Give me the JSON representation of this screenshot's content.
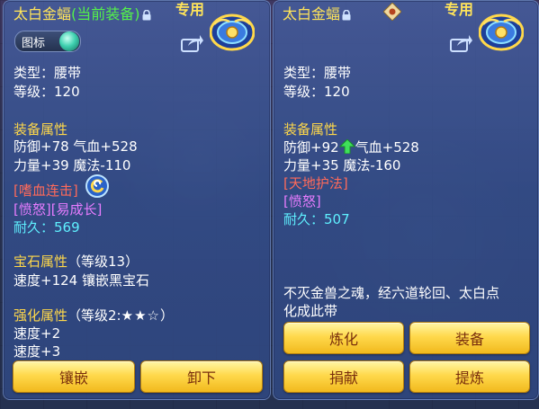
{
  "left": {
    "title_name": "太白金蝠",
    "title_status": "(当前装备)",
    "exclusive": "专用",
    "badge_label": "图标",
    "type_line": "类型：腰带",
    "level_line": "等级：120",
    "attr_header": "装备属性",
    "stat_line1": "防御+78 气血+528",
    "stat_line2": "力量+39 魔法-110",
    "special_skill": "[嗜血连击]",
    "effects": "[愤怒][易成长]",
    "durability_label": "耐久：",
    "durability_value": "569",
    "gem_header": "宝石属性",
    "gem_level": "（等级13）",
    "gem_line": "速度+124 镶嵌黑宝石",
    "enhance_header": "强化属性",
    "enhance_level": "（等级2:",
    "enhance_stars": "★★☆",
    "enhance_close": "）",
    "enhance_line1": "速度+2",
    "enhance_line2": "速度+3",
    "btn_inlay": "镶嵌",
    "btn_unequip": "卸下"
  },
  "right": {
    "title_name": "太白金蝠",
    "exclusive": "专用",
    "type_line": "类型：腰带",
    "level_line": "等级：120",
    "attr_header": "装备属性",
    "stat_line1a": "防御+92",
    "stat_line1b": "气血+528",
    "stat_line2": "力量+35 魔法-160",
    "special_skill": "[天地护法]",
    "effects": "[愤怒]",
    "durability_label": "耐久：",
    "durability_value": "507",
    "desc_line1": "不灭金兽之魂，经六道轮回、太白点",
    "desc_line2": "化成此带",
    "btn_refine": "炼化",
    "btn_equip": "装备",
    "btn_donate": "捐献",
    "btn_extract": "提炼"
  },
  "colors": {
    "title": "#ffe45a",
    "equipped": "#54f24a",
    "section": "#ffd84a",
    "skill": "#ff6a5a",
    "effect": "#e77cff",
    "durability": "#5ff0ff",
    "button_text": "#7a2f0d"
  },
  "icons": [
    "lock-icon",
    "share-icon",
    "belt-item-icon",
    "skill-swirl-icon",
    "up-arrow-icon",
    "seal-icon",
    "orb-icon"
  ]
}
